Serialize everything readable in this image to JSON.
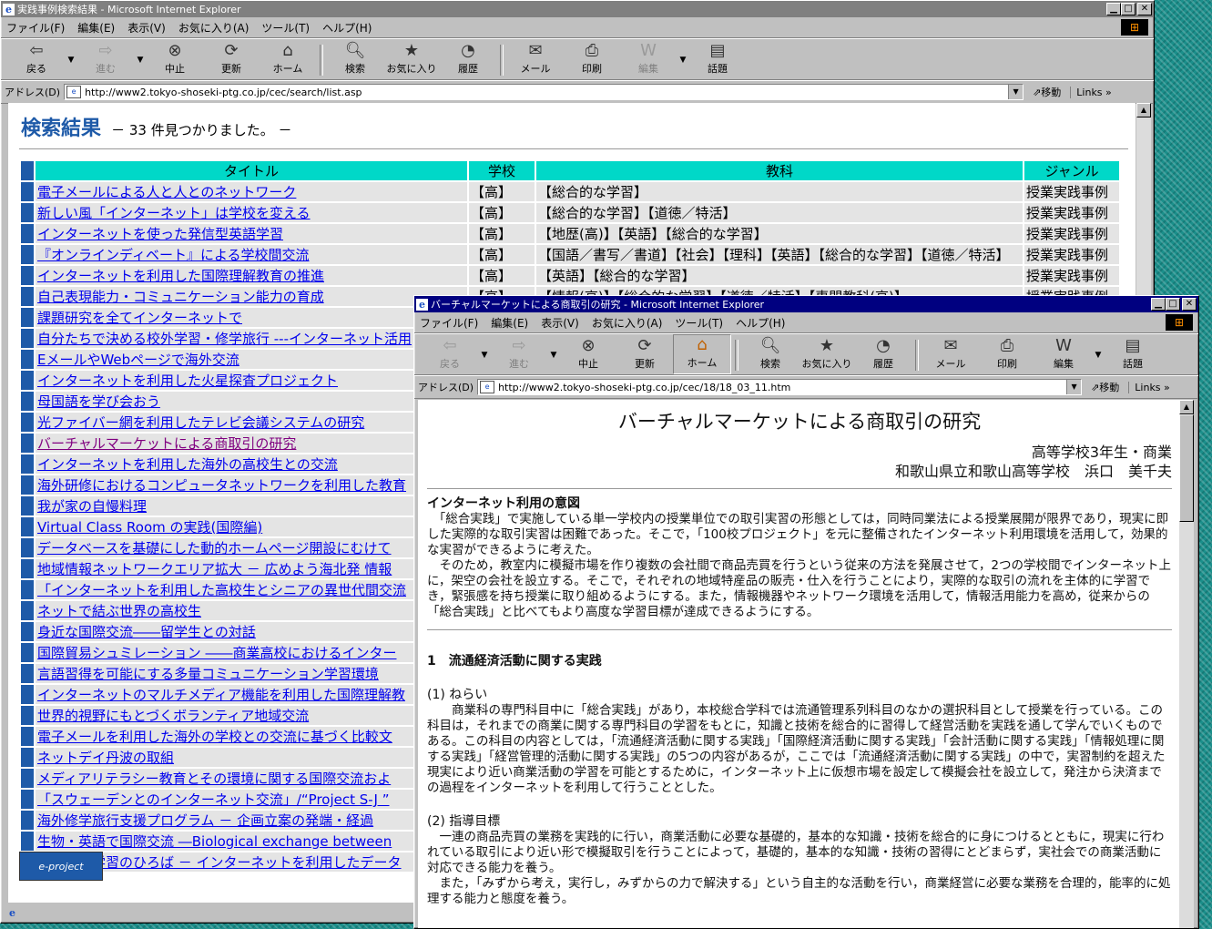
{
  "back_window": {
    "title": "実践事例検索結果 - Microsoft Internet Explorer",
    "menu": [
      "ファイル(F)",
      "編集(E)",
      "表示(V)",
      "お気に入り(A)",
      "ツール(T)",
      "ヘルプ(H)"
    ],
    "toolbar": {
      "back": "戻る",
      "forward": "進む",
      "stop": "中止",
      "refresh": "更新",
      "home": "ホーム",
      "search": "検索",
      "favorites": "お気に入り",
      "history": "履歴",
      "mail": "メール",
      "print": "印刷",
      "edit": "編集",
      "discuss": "話題"
    },
    "address_label": "アドレス(D)",
    "address": "http://www2.tokyo-shoseki-ptg.co.jp/cec/search/list.asp",
    "go": "移動",
    "links": "Links",
    "heading": "検索結果",
    "result_count": "－ 33 件見つかりました。 －",
    "columns": [
      "タイトル",
      "学校",
      "教科",
      "ジャンル"
    ],
    "rows": [
      {
        "title": "電子メールによる人と人とのネットワーク",
        "school": "【高】",
        "subject": "【総合的な学習】",
        "genre": "授業実践事例"
      },
      {
        "title": "新しい風「インターネット」は学校を変える",
        "school": "【高】",
        "subject": "【総合的な学習】【道徳／特活】",
        "genre": "授業実践事例"
      },
      {
        "title": "インターネットを使った発信型英語学習",
        "school": "【高】",
        "subject": "【地歴(高)】【英語】【総合的な学習】",
        "genre": "授業実践事例"
      },
      {
        "title": "『オンラインディベート』による学校間交流",
        "school": "【高】",
        "subject": "【国語／書写／書道】【社会】【理科】【英語】【総合的な学習】【道徳／特活】",
        "genre": "授業実践事例"
      },
      {
        "title": "インターネットを利用した国際理解教育の推進",
        "school": "【高】",
        "subject": "【英語】【総合的な学習】",
        "genre": "授業実践事例"
      },
      {
        "title": "自己表現能力・コミュニケーション能力の育成",
        "school": "【高】",
        "subject": "【情報(高)】【総合的な学習】【道徳／特活】【専門教科(高)】",
        "genre": "授業実践事例"
      },
      {
        "title": "課題研究を全てインターネットで",
        "school": "",
        "subject": "",
        "genre": ""
      },
      {
        "title": "自分たちで決める校外学習・修学旅行 ---インターネット活用",
        "school": "",
        "subject": "",
        "genre": ""
      },
      {
        "title": "EメールやWebページで海外交流",
        "school": "",
        "subject": "",
        "genre": ""
      },
      {
        "title": "インターネットを利用した火星探査プロジェクト",
        "school": "",
        "subject": "",
        "genre": ""
      },
      {
        "title": "母国語を学び会おう",
        "school": "",
        "subject": "",
        "genre": ""
      },
      {
        "title": "光ファイバー網を利用したテレビ会議システムの研究",
        "school": "",
        "subject": "",
        "genre": ""
      },
      {
        "title": "バーチャルマーケットによる商取引の研究",
        "school": "",
        "subject": "",
        "genre": "",
        "visited": true
      },
      {
        "title": "インターネットを利用した海外の高校生との交流",
        "school": "",
        "subject": "",
        "genre": ""
      },
      {
        "title": "海外研修におけるコンピュータネットワークを利用した教育",
        "school": "",
        "subject": "",
        "genre": ""
      },
      {
        "title": "我が家の自慢料理",
        "school": "",
        "subject": "",
        "genre": ""
      },
      {
        "title": "Virtual Class Room の実践(国際編)",
        "school": "",
        "subject": "",
        "genre": ""
      },
      {
        "title": "データベースを基礎にした動的ホームページ開設にむけて",
        "school": "",
        "subject": "",
        "genre": ""
      },
      {
        "title": "地域情報ネットワークエリア拡大 － 広めよう海北発 情報",
        "school": "",
        "subject": "",
        "genre": ""
      },
      {
        "title": "「インターネットを利用した高校生とシニアの異世代間交流",
        "school": "",
        "subject": "",
        "genre": ""
      },
      {
        "title": "ネットで結ぶ世界の高校生",
        "school": "",
        "subject": "",
        "genre": ""
      },
      {
        "title": "身近な国際交流――留学生との対話",
        "school": "",
        "subject": "",
        "genre": ""
      },
      {
        "title": "国際貿易シュミレーション ――商業高校におけるインター",
        "school": "",
        "subject": "",
        "genre": ""
      },
      {
        "title": "言語習得を可能にする多量コミュニケーション学習環境",
        "school": "",
        "subject": "",
        "genre": ""
      },
      {
        "title": "インターネットのマルチメディア機能を利用した国際理解教",
        "school": "",
        "subject": "",
        "genre": ""
      },
      {
        "title": "世界的視野にもとづくボランティア地域交流",
        "school": "",
        "subject": "",
        "genre": ""
      },
      {
        "title": "電子メールを利用した海外の学校との交流に基づく比較文",
        "school": "",
        "subject": "",
        "genre": ""
      },
      {
        "title": "ネットデイ丹波の取組",
        "school": "",
        "subject": "",
        "genre": ""
      },
      {
        "title": "メディアリテラシー教育とその環境に関する国際交流およ",
        "school": "",
        "subject": "",
        "genre": ""
      },
      {
        "title": "「スウェーデンとのインターネット交流」/“Project S-J ”",
        "school": "",
        "subject": "",
        "genre": ""
      },
      {
        "title": "海外修学旅行支援プログラム － 企画立案の発端・経過",
        "school": "",
        "subject": "",
        "genre": ""
      },
      {
        "title": "生物・英語で国際交流 ―Biological exchange between",
        "school": "",
        "subject": "",
        "genre": ""
      },
      {
        "title": "総合的な学習のひろば － インターネットを利用したデータ",
        "school": "",
        "subject": "",
        "genre": ""
      }
    ],
    "logo_text": "e-project"
  },
  "front_window": {
    "title": "バーチャルマーケットによる商取引の研究 - Microsoft Internet Explorer",
    "menu": [
      "ファイル(F)",
      "編集(E)",
      "表示(V)",
      "お気に入り(A)",
      "ツール(T)",
      "ヘルプ(H)"
    ],
    "toolbar": {
      "back": "戻る",
      "forward": "進む",
      "stop": "中止",
      "refresh": "更新",
      "home": "ホーム",
      "search": "検索",
      "favorites": "お気に入り",
      "history": "履歴",
      "mail": "メール",
      "print": "印刷",
      "edit": "編集",
      "discuss": "話題"
    },
    "address_label": "アドレス(D)",
    "address": "http://www2.tokyo-shoseki-ptg.co.jp/cec/18/18_03_11.htm",
    "go": "移動",
    "links": "Links",
    "doc": {
      "title": "バーチャルマーケットによる商取引の研究",
      "author_line1": "高等学校3年生・商業",
      "author_line2": "和歌山県立和歌山高等学校　浜口　美千夫",
      "intent_heading": "インターネット利用の意図",
      "intent_p1": "「総合実践」で実施している単一学校内の授業単位での取引実習の形態としては，同時同業法による授業展開が限界であり，現実に即した実際的な取引実習は困難であった。そこで，「100校プロジェクト」を元に整備されたインターネット利用環境を活用して，効果的な実習ができるように考えた。",
      "intent_p2": "そのため，教室内に模擬市場を作り複数の会社間で商品売買を行うという従来の方法を発展させて，2つの学校間でインターネット上に，架空の会社を設立する。そこで，それぞれの地域特産品の販売・仕入を行うことにより，実際的な取引の流れを主体的に学習でき，緊張感を持ち授業に取り組めるようにする。また，情報機器やネットワーク環境を活用して，情報活用能力を高め，従来からの「総合実践」と比べてもより高度な学習目標が達成できるようにする。",
      "section1": "1　流通経済活動に関する実践",
      "aim_heading": "(1) ねらい",
      "aim_p": "商業科の専門科目中に「総合実践」があり，本校総合学科では流通管理系列科目のなかの選択科目として授業を行っている。この科目は，それまでの商業に関する専門科目の学習をもとに，知識と技術を総合的に習得して経営活動を実践を通して学んでいくものである。この科目の内容としては，「流通経済活動に関する実践」「国際経済活動に関する実践」「会計活動に関する実践」「情報処理に関する実践」「経営管理的活動に関する実践」の5つの内容があるが，ここでは「流通経済活動に関する実践」の中で，実習制約を超えた現実により近い商業活動の学習を可能とするために，インターネット上に仮想市場を設定して模擬会社を設立して，発注から決済までの過程をインターネットを利用して行うこととした。",
      "goal_heading": "(2) 指導目標",
      "goal_p1": "一連の商品売買の業務を実践的に行い，商業活動に必要な基礎的，基本的な知識・技術を総合的に身につけるとともに，現実に行われている取引により近い形で模擬取引を行うことによって，基礎的，基本的な知識・技術の習得にとどまらず，実社会での商業活動に対応できる能力を養う。",
      "goal_p2": "また，「みずから考え，実行し，みずからの力で解決する」という自主的な活動を行い，商業経営に必要な業務を合理的，能率的に処理する能力と態度を養う。"
    }
  }
}
